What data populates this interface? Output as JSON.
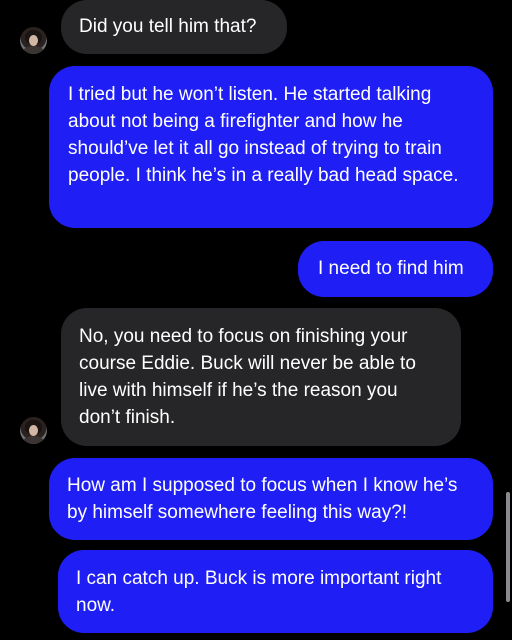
{
  "conversation": {
    "messages": [
      {
        "sender": "them",
        "text": "Did you tell him that?"
      },
      {
        "sender": "me",
        "text": "I tried but he won’t listen. He started talking about not being a firefighter and how he should’ve let it all go instead of trying to train people. I think he’s in a really bad head space."
      },
      {
        "sender": "me",
        "text": "I need to find him"
      },
      {
        "sender": "them",
        "text": "No, you need to focus on finishing your course Eddie. Buck will never be able to live with himself if he’s the reason you don’t finish."
      },
      {
        "sender": "me",
        "text": "How am I supposed to focus when I know he’s by himself somewhere feeling this way?!"
      },
      {
        "sender": "me",
        "text": "I can catch up. Buck is more important right now."
      }
    ]
  },
  "colors": {
    "background": "#000000",
    "incoming_bubble": "#262628",
    "outgoing_bubble": "#1f1ff5",
    "text": "#ffffff"
  }
}
